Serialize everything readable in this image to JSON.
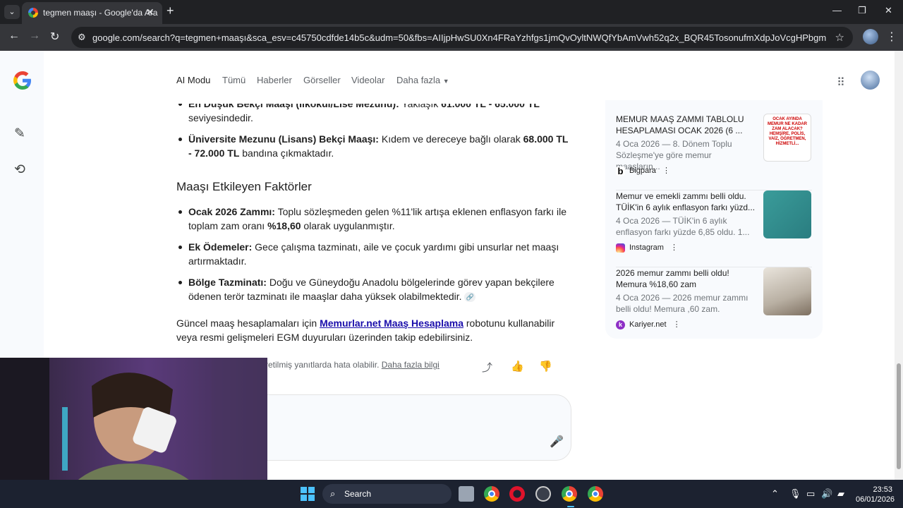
{
  "browser": {
    "tab_title": "tegmen maaşı - Google'da Ara",
    "url": "google.com/search?q=tegmen+maaşı&sca_esv=c45750cdfde14b5c&udm=50&fbs=AIIjpHwSU0Xn4FRaYzhfgs1jmQvOyltNWQfYbAmVwh52q2x_BQR45TosonufmXdpJoVcgHPbgmZRYP5wvwDSdRngeU..."
  },
  "search_tabs": [
    "AI Modu",
    "Tümü",
    "Haberler",
    "Görseller",
    "Videolar",
    "Daha fazla"
  ],
  "answer": {
    "bullet_partial_bold": "En Düşük Bekçi Maaşı (İlkokul/Lise Mezunu):",
    "bullet_partial_text": " Yaklaşık ",
    "bullet_partial_amount": "61.000 TL - 65.000 TL",
    "bullet_partial_tail": "seviyesindedir.",
    "bullet_uni_bold": "Üniversite Mezunu (Lisans) Bekçi Maaşı:",
    "bullet_uni_text": " Kıdem ve dereceye bağlı olarak ",
    "bullet_uni_amount": "68.000 TL - 72.000 TL",
    "bullet_uni_tail": " bandına çıkmaktadır.",
    "heading": "Maaşı Etkileyen Faktörler",
    "factors": [
      {
        "bold": "Ocak 2026 Zammı:",
        "text": " Toplu sözleşmeden gelen %11'lik artışa eklenen enflasyon farkı ile toplam zam oranı ",
        "bold2": "%18,60",
        "tail": " olarak uygulanmıştır."
      },
      {
        "bold": "Ek Ödemeler:",
        "text": " Gece çalışma tazminatı, aile ve çocuk yardımı gibi unsurlar net maaşı artırmaktadır."
      },
      {
        "bold": "Bölge Tazminatı:",
        "text": " Doğu ve Güneydoğu Anadolu bölgelerinde görev yapan bekçilere ödenen terör tazminatı ile maaşlar daha yüksek olabilmektedir."
      }
    ],
    "closing_pre": "Güncel maaş hesaplamaları için ",
    "closing_link": "Memurlar.net Maaş Hesaplama",
    "closing_post": " robotunu kullanabilir veya resmi gelişmeleri EGM duyuruları üzerinden takip edebilirsiniz.",
    "disclaimer_visible": "retilmiş yanıtlarda hata olabilir.",
    "disclaimer_link": "Daha fazla bilgi"
  },
  "sources": [
    {
      "title": "MEMUR MAAŞ ZAMMI TABLOLU HESAPLAMASI OCAK 2026 (6 ...",
      "snippet": "4 Oca 2026 — 8. Dönem Toplu Sözleşme'ye göre memur maaşların...",
      "site": "Bigpara",
      "logo": "b",
      "logo_color": "#000000",
      "thumb_text": "OCAK AYINDA MEMUR NE KADAR ZAM ALACAK? HEMŞİRE, POLİS, VAİZ, ÖĞRETMEN, HİZMETLİ..."
    },
    {
      "title": "Memur ve emekli zammı belli oldu. TÜİK'in 6 aylık enflasyon farkı yüzd...",
      "snippet": "4 Oca 2026 — TÜİK'in 6 aylık enflasyon farkı yüzde 6,85 oldu. 1...",
      "site": "Instagram",
      "logo": "◎",
      "logo_color": "#d6249f"
    },
    {
      "title": "2026 memur zammı belli oldu! Memura %18,60 zam",
      "snippet": "4 Oca 2026 — 2026 memur zammı belli oldu! Memura ,60 zam.",
      "site": "Kariyer.net",
      "logo": "k",
      "logo_color": "#8e2fc6"
    }
  ],
  "taskbar": {
    "search_label": "Search",
    "time": "23:53",
    "date": "06/01/2026"
  },
  "colors": {
    "link": "#1a0dab",
    "tab_strip": "#202124",
    "toolbar": "#35363a",
    "taskbar": "#1c2230"
  }
}
